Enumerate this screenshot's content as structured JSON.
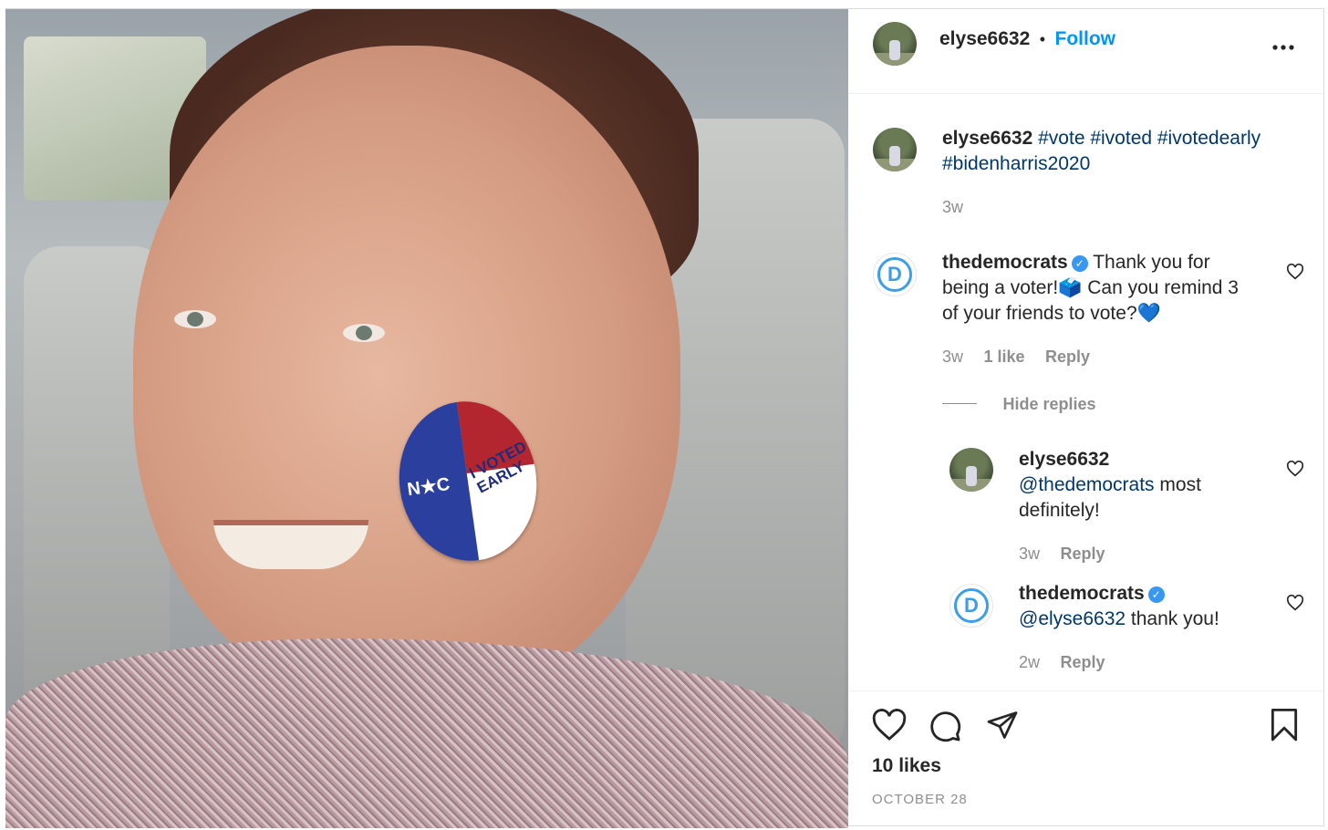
{
  "post": {
    "author": "elyse6632",
    "dot": "•",
    "follow_label": "Follow",
    "more_icon": "more-options-icon",
    "more_glyph": "•••"
  },
  "caption": {
    "username": "elyse6632",
    "tags_line1": "#vote #ivoted #ivotedearly",
    "tags_line2": "#bidenharris2020",
    "time": "3w"
  },
  "comments": [
    {
      "username": "thedemocrats",
      "verified": true,
      "line1": "Thank you for",
      "line2": "being a voter!🗳️ Can you remind 3",
      "line3": "of your friends to vote?💙",
      "time": "3w",
      "likes": "1 like",
      "reply_label": "Reply"
    }
  ],
  "hide_replies_label": "Hide replies",
  "replies": [
    {
      "username": "elyse6632",
      "mention": "@thedemocrats",
      "text_after_mention": " most",
      "line2": "definitely!",
      "time": "3w",
      "reply_label": "Reply"
    },
    {
      "username": "thedemocrats",
      "verified": true,
      "mention": "@elyse6632",
      "text_after_mention": " thank you!",
      "time": "2w",
      "reply_label": "Reply"
    }
  ],
  "footer": {
    "likes": "10 likes",
    "date": "OCTOBER 28"
  },
  "sticker": {
    "nc": "N★C",
    "line1": "I VOTED",
    "line2": "EARLY"
  },
  "colors": {
    "link_blue": "#0095f6",
    "hashtag": "#00376b",
    "muted": "#8e8e8e",
    "dem_blue": "#3a9ee8"
  }
}
